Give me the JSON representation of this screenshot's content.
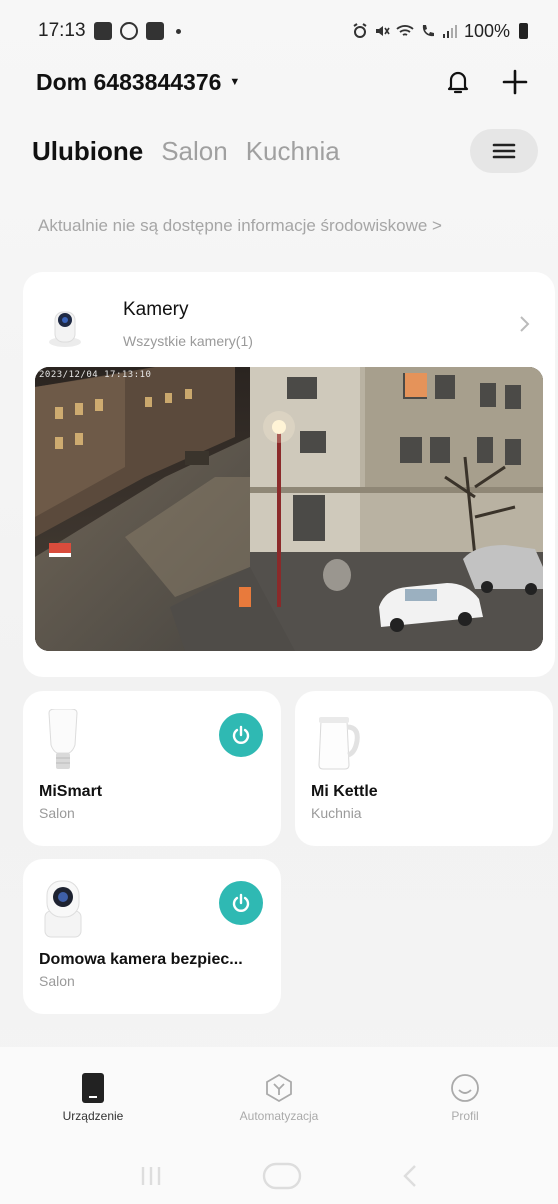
{
  "status": {
    "time": "17:13",
    "battery": "100%"
  },
  "header": {
    "home_name": "Dom 6483844376"
  },
  "tabs": [
    {
      "label": "Ulubione",
      "active": true
    },
    {
      "label": "Salon",
      "active": false
    },
    {
      "label": "Kuchnia",
      "active": false
    }
  ],
  "environment": {
    "text": "Aktualnie nie są dostępne informacje środowiskowe >"
  },
  "cameras": {
    "title": "Kamery",
    "subtitle": "Wszystkie kamery(1)",
    "feed_timestamp": "2023/12/04 17:13:10"
  },
  "devices": [
    {
      "name": "MiSmart",
      "room": "Salon",
      "icon": "bulb-icon",
      "has_power": true
    },
    {
      "name": "Mi Kettle",
      "room": "Kuchnia",
      "icon": "kettle-icon",
      "has_power": false
    },
    {
      "name": "Domowa kamera bezpiec...",
      "room": "Salon",
      "icon": "camera-icon",
      "has_power": true
    }
  ],
  "bottom_nav": [
    {
      "label": "Urządzenie",
      "icon": "device-icon",
      "active": true
    },
    {
      "label": "Automatyzacja",
      "icon": "automation-icon",
      "active": false
    },
    {
      "label": "Profil",
      "icon": "profile-icon",
      "active": false
    }
  ],
  "colors": {
    "accent": "#2fb9b3",
    "inactive_tab": "#a0a0a0"
  }
}
